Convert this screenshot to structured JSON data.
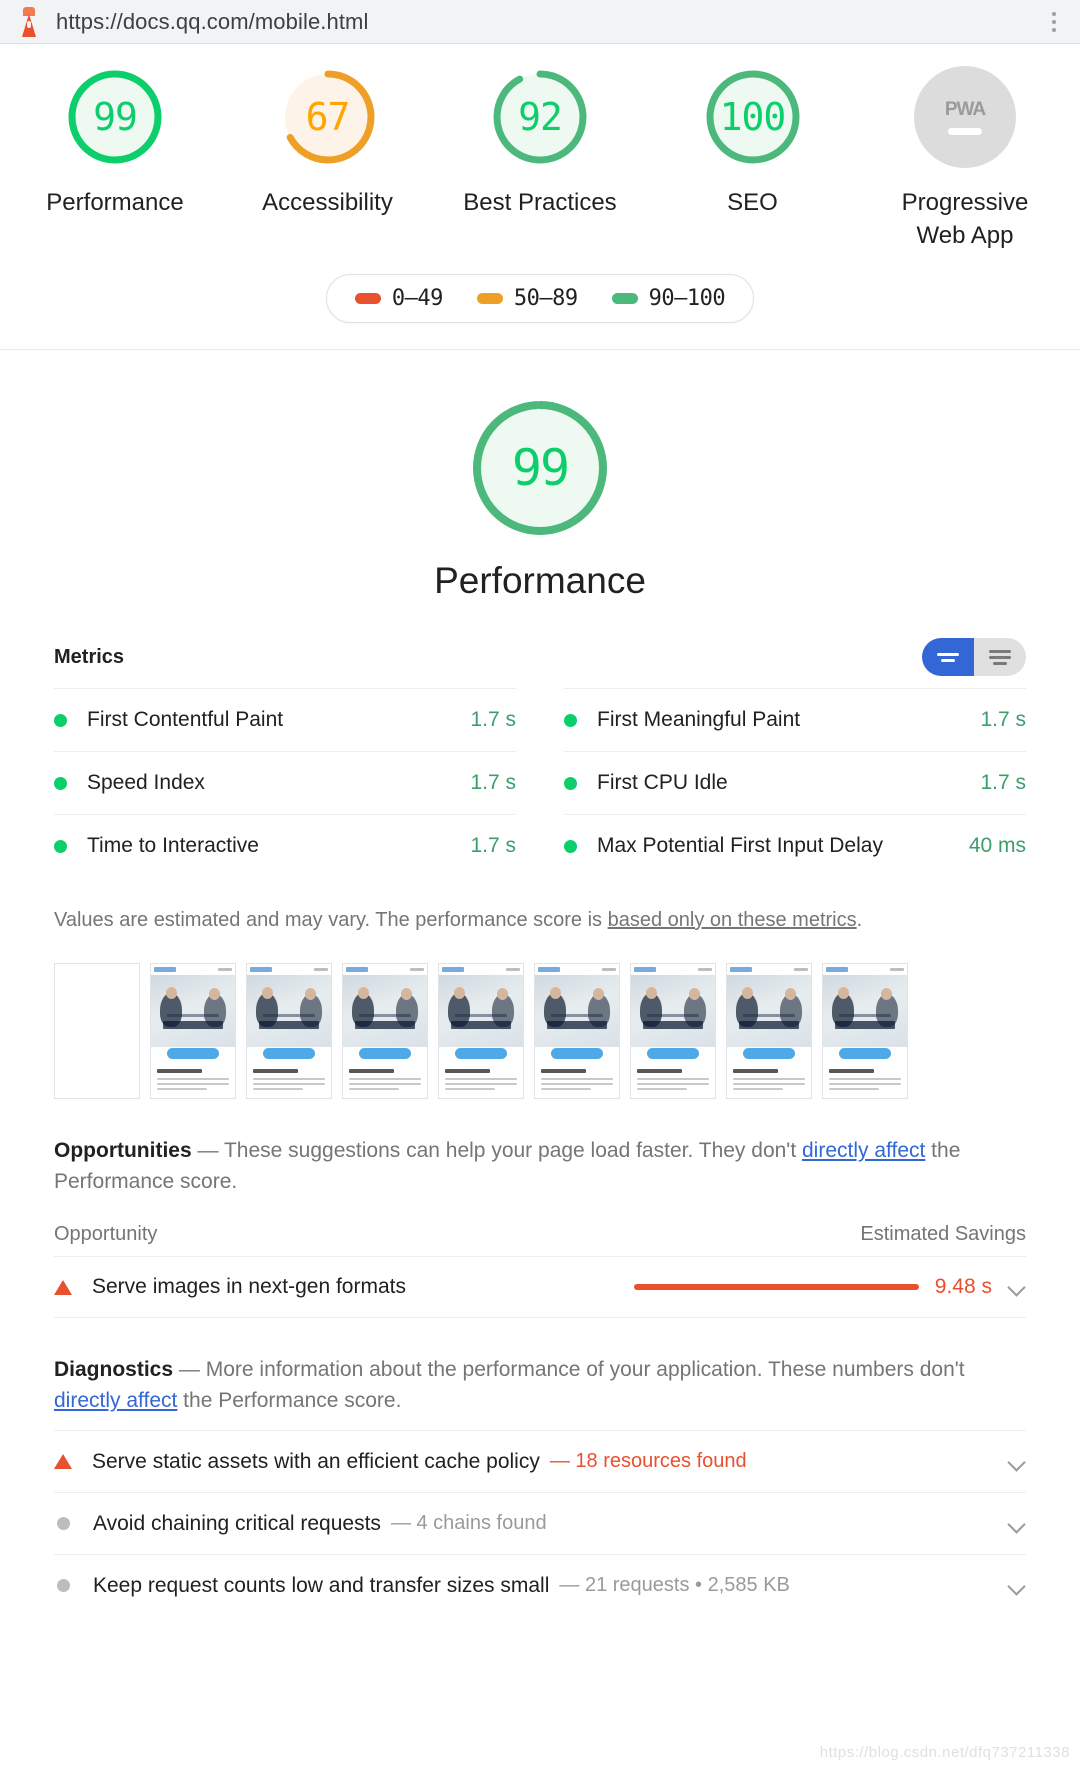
{
  "urlbar": {
    "url": "https://docs.qq.com/mobile.html",
    "icon": "lighthouse-icon",
    "menu_icon": "kebab-menu-icon"
  },
  "category_scores": [
    {
      "score": "99",
      "label": "Performance",
      "state": "pass",
      "color": "#0cce6b"
    },
    {
      "score": "67",
      "label": "Accessibility",
      "state": "average",
      "color": "#ffa400"
    },
    {
      "score": "92",
      "label": "Best Practices",
      "state": "pass",
      "color": "#0cce6b"
    },
    {
      "score": "100",
      "label": "SEO",
      "state": "pass",
      "color": "#0cce6b"
    },
    {
      "score": "PWA",
      "label": "Progressive Web App",
      "state": "null",
      "color": "#dcdcdc"
    }
  ],
  "legend": [
    {
      "range": "0–49",
      "color": "#e8502e"
    },
    {
      "range": "50–89",
      "color": "#ffa400"
    },
    {
      "range": "90–100",
      "color": "#0cce6b"
    }
  ],
  "big_score": {
    "value": "99",
    "label": "Performance",
    "color": "#0cce6b"
  },
  "metrics": {
    "title": "Metrics",
    "toggle": {
      "selected_icon": "compact-list-icon",
      "other_icon": "expanded-list-icon",
      "selected_color": "#3367d6"
    },
    "left": [
      {
        "name": "First Contentful Paint",
        "value": "1.7 s",
        "status": "pass"
      },
      {
        "name": "Speed Index",
        "value": "1.7 s",
        "status": "pass"
      },
      {
        "name": "Time to Interactive",
        "value": "1.7 s",
        "status": "pass"
      }
    ],
    "right": [
      {
        "name": "First Meaningful Paint",
        "value": "1.7 s",
        "status": "pass"
      },
      {
        "name": "First CPU Idle",
        "value": "1.7 s",
        "status": "pass"
      },
      {
        "name": "Max Potential First Input Delay",
        "value": "40 ms",
        "status": "pass"
      }
    ],
    "note_pre": "Values are estimated and may vary. The performance score is ",
    "note_link": "based only on these metrics",
    "note_post": "."
  },
  "filmstrip": {
    "count": 9,
    "blank_first": true
  },
  "opportunities": {
    "heading": "Opportunities",
    "dash": "—",
    "desc_pre": "These suggestions can help your page load faster. They don't ",
    "desc_link": "directly affect",
    "desc_post": " the Performance score.",
    "col_left": "Opportunity",
    "col_right": "Estimated Savings",
    "rows": [
      {
        "icon": "warning-triangle-icon",
        "name": "Serve images in next-gen formats",
        "value": "9.48 s",
        "bar_color": "#e8502e",
        "expand_icon": "chevron-down-icon"
      }
    ]
  },
  "diagnostics": {
    "heading": "Diagnostics",
    "dash": "—",
    "desc_pre": "More information about the performance of your application. These numbers don't ",
    "desc_link": "directly affect",
    "desc_post": " the Performance score.",
    "rows": [
      {
        "icon": "warning-triangle-icon",
        "name": "Serve static assets with an efficient cache policy",
        "sub": "— 18 resources found",
        "sub_style": "red",
        "expand_icon": "chevron-down-icon"
      },
      {
        "icon": "neutral-circle-icon",
        "name": "Avoid chaining critical requests",
        "sub": "— 4 chains found",
        "sub_style": "grey",
        "expand_icon": "chevron-down-icon"
      },
      {
        "icon": "neutral-circle-icon",
        "name": "Keep request counts low and transfer sizes small",
        "sub": "— 21 requests • 2,585 KB",
        "sub_style": "grey",
        "expand_icon": "chevron-down-icon"
      }
    ]
  },
  "watermark": "https://blog.csdn.net/dfq737211338"
}
